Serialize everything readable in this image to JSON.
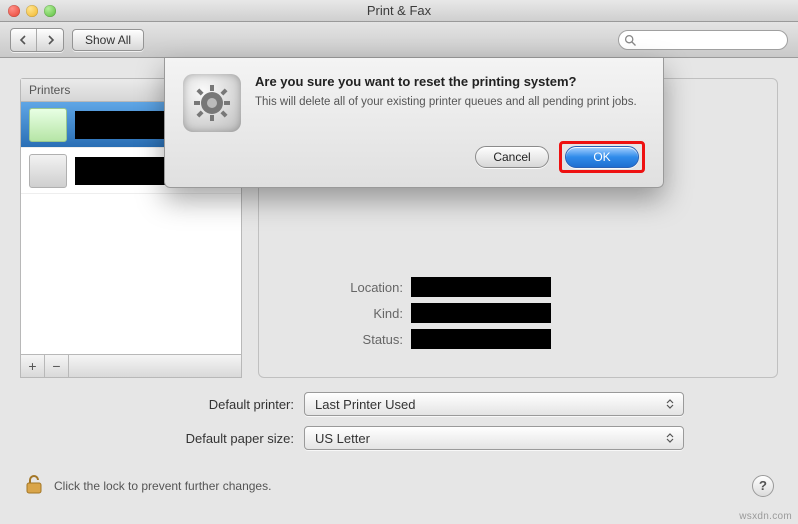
{
  "window": {
    "title": "Print & Fax",
    "show_all": "Show All"
  },
  "search": {
    "placeholder": ""
  },
  "printers": {
    "header": "Printers",
    "add_label": "+",
    "remove_label": "−",
    "items": [
      {
        "icon": "printer-green-icon"
      },
      {
        "icon": "printer-gray-icon"
      }
    ]
  },
  "detail": {
    "location_label": "Location:",
    "kind_label": "Kind:",
    "status_label": "Status:"
  },
  "defaults": {
    "printer_label": "Default printer:",
    "printer_value": "Last Printer Used",
    "paper_label": "Default paper size:",
    "paper_value": "US Letter"
  },
  "lock": {
    "text": "Click the lock to prevent further changes."
  },
  "dialog": {
    "title": "Are you sure you want to reset the printing system?",
    "message": "This will delete all of your existing printer queues and all pending print jobs.",
    "cancel": "Cancel",
    "ok": "OK"
  },
  "help_label": "?",
  "watermark": "wsxdn.com"
}
